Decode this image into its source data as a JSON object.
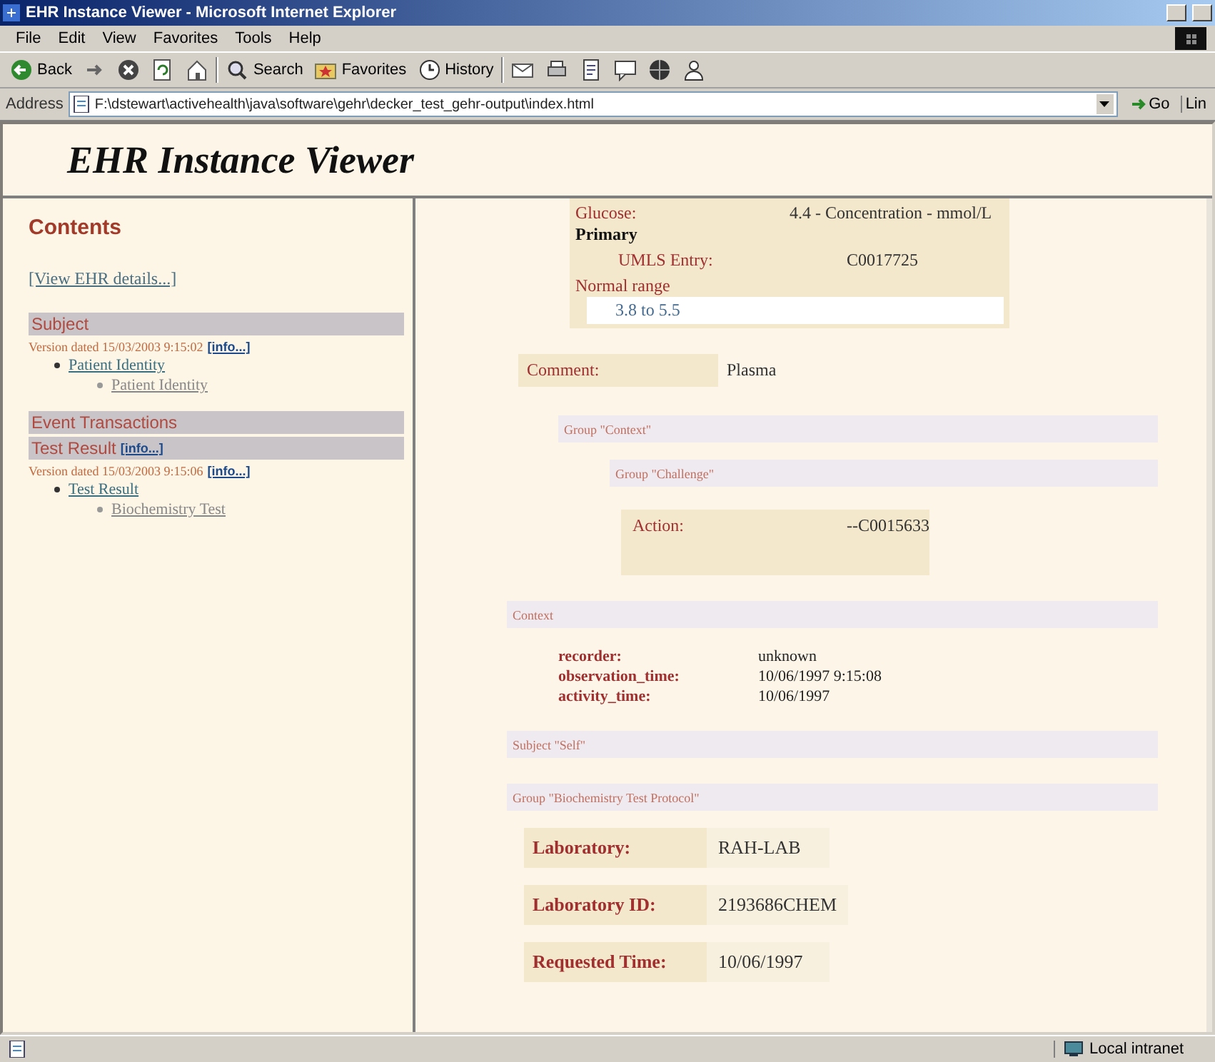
{
  "window": {
    "title": "EHR Instance Viewer - Microsoft Internet Explorer"
  },
  "menu": [
    "File",
    "Edit",
    "View",
    "Favorites",
    "Tools",
    "Help"
  ],
  "toolbar": [
    {
      "kind": "back",
      "label": "Back"
    },
    {
      "kind": "forward"
    },
    {
      "kind": "stop"
    },
    {
      "kind": "refresh"
    },
    {
      "kind": "home"
    },
    {
      "kind": "search",
      "label": "Search"
    },
    {
      "kind": "favorites",
      "label": "Favorites"
    },
    {
      "kind": "history",
      "label": "History"
    },
    {
      "kind": "mail"
    },
    {
      "kind": "print"
    },
    {
      "kind": "edit"
    },
    {
      "kind": "discuss"
    },
    {
      "kind": "messenger"
    },
    {
      "kind": "people"
    }
  ],
  "address": {
    "label": "Address",
    "value": "F:\\dstewart\\activehealth\\java\\software\\gehr\\decker_test_gehr-output\\index.html",
    "go": "Go",
    "links": "Lin"
  },
  "page": {
    "heading": "EHR Instance Viewer"
  },
  "sidebar": {
    "title": "Contents",
    "details_link": "[View EHR details...]",
    "blocks": [
      {
        "kind": "bar",
        "text": "Subject"
      },
      {
        "kind": "version",
        "text": "Version dated 15/03/2003 9:15:02",
        "info": "[info...]"
      },
      {
        "kind": "tree",
        "items": [
          {
            "label": "Patient Identity",
            "children": [
              {
                "label": "Patient Identity"
              }
            ]
          }
        ]
      },
      {
        "kind": "bar",
        "text": "Event Transactions"
      },
      {
        "kind": "bar",
        "text": "Test Result",
        "info": "[info...]"
      },
      {
        "kind": "version",
        "text": "Version dated 15/03/2003 9:15:06",
        "info": "[info...]"
      },
      {
        "kind": "tree",
        "items": [
          {
            "label": "Test Result",
            "children": [
              {
                "label": "Biochemistry Test"
              }
            ]
          }
        ]
      }
    ]
  },
  "main": [
    {
      "kind": "quantity",
      "name": "Glucose:",
      "value": "4.4 - Concentration - mmol/L",
      "primary": "Primary",
      "code_label": "UMLS Entry:",
      "code": "C0017725",
      "range_label": "Normal range",
      "range": "3.8 to 5.5"
    },
    {
      "kind": "field",
      "label": "Comment:",
      "value": "Plasma"
    },
    {
      "kind": "group",
      "text": "Group \"Context\"",
      "children": [
        {
          "kind": "group",
          "text": "Group \"Challenge\"",
          "children": [
            {
              "kind": "action",
              "label": "Action:",
              "value": "--C0015633"
            }
          ]
        }
      ]
    },
    {
      "kind": "section",
      "text": "Context",
      "children": [
        {
          "kind": "attributes",
          "rows": [
            {
              "label": "recorder:",
              "value": "unknown"
            },
            {
              "label": "observation_time:",
              "value": "10/06/1997 9:15:08"
            },
            {
              "label": "activity_time:",
              "value": "10/06/1997"
            }
          ]
        }
      ]
    },
    {
      "kind": "section",
      "text": "Subject \"Self\""
    },
    {
      "kind": "section",
      "text": "Group \"Biochemistry Test Protocol\"",
      "children": [
        {
          "kind": "bigfield",
          "label": "Laboratory:",
          "value": "RAH-LAB"
        },
        {
          "kind": "bigfield",
          "label": "Laboratory ID:",
          "value": "2193686CHEM"
        },
        {
          "kind": "bigfield",
          "label": "Requested Time:",
          "value": "10/06/1997"
        }
      ]
    }
  ],
  "status_bar": {
    "zone": "Local intranet"
  }
}
